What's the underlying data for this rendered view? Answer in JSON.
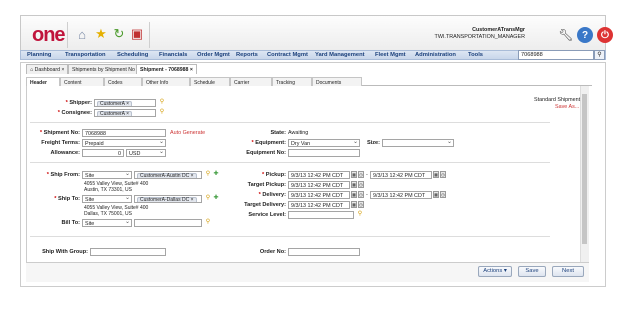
{
  "app": {
    "logo": "one"
  },
  "user": {
    "name": "CustomerATransMgr",
    "org": "TWI.TRANSPORTATION_MANAGER"
  },
  "menu": [
    "Planning",
    "Transportation",
    "Scheduling",
    "Financials",
    "Order Mgmt",
    "Reports",
    "Contract Mgmt",
    "Yard Management",
    "Fleet Mgmt",
    "Administration",
    "Tools"
  ],
  "search": {
    "value": "7068988"
  },
  "page_tabs": [
    "Dashboard",
    "Shipments by Shipment No",
    "Shipment - 7068988"
  ],
  "sub_tabs": [
    "Header",
    "Content",
    "Codes",
    "Other Info",
    "Schedule",
    "Carrier",
    "Tracking",
    "Documents"
  ],
  "side": {
    "title": "Standard Shipment",
    "save_as": "Save As..."
  },
  "form": {
    "shipper_label": "Shipper:",
    "shipper_value": "CustomerA",
    "consignee_label": "Consignee:",
    "consignee_value": "CustomerA",
    "shipment_no_label": "Shipment No:",
    "shipment_no_value": "7068988",
    "auto_generate": "Auto Generate",
    "freight_terms_label": "Freight Terms:",
    "freight_terms_value": "Prepaid",
    "allowance_label": "Allowance:",
    "allowance_value": "0",
    "allowance_currency": "USD",
    "state_label": "State:",
    "state_value": "Awaiting",
    "equipment_label": "Equipment:",
    "equipment_value": "Dry Van",
    "size_label": "Size:",
    "equipment_no_label": "Equipment No:",
    "ship_from_label": "Ship From:",
    "ship_from_type": "Site",
    "ship_from_value": "CustomerA-Austin DC",
    "ship_from_addr1": "4055 Valley View, Suite# 400",
    "ship_from_addr2": "Austin, TX 73301, US",
    "ship_to_label": "Ship To:",
    "ship_to_type": "Site",
    "ship_to_value": "CustomerA-Dallas DC",
    "ship_to_addr1": "4055 Valley View, Suite# 400",
    "ship_to_addr2": "Dallas, TX 75001, US",
    "bill_to_label": "Bill To:",
    "bill_to_type": "Site",
    "pickup_label": "Pickup:",
    "pickup_from": "9/3/13 12:42 PM CDT",
    "pickup_to": "9/3/13 12:42 PM CDT",
    "target_pickup_label": "Target Pickup:",
    "target_pickup_value": "9/3/13 12:42 PM CDT",
    "delivery_label": "Delivery:",
    "delivery_from": "9/3/13 12:42 PM CDT",
    "delivery_to": "9/3/13 12:42 PM CDT",
    "target_delivery_label": "Target Delivery:",
    "target_delivery_value": "9/3/13 12:42 PM CDT",
    "service_level_label": "Service Level:",
    "ship_with_group_label": "Ship With Group:",
    "order_no_label": "Order No:"
  },
  "buttons": {
    "actions": "Actions ▾",
    "save": "Save",
    "next": "Next"
  }
}
